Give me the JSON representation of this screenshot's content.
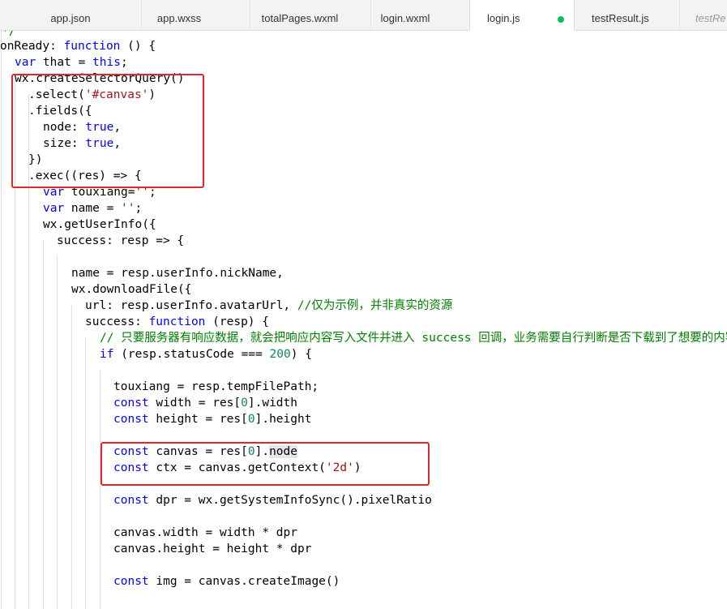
{
  "tabs": [
    {
      "label": "app.json"
    },
    {
      "label": "app.wxss"
    },
    {
      "label": "totalPages.wxml"
    },
    {
      "label": "login.wxml"
    },
    {
      "label": "login.js",
      "active": true,
      "modified": true
    },
    {
      "label": "testResult.js"
    },
    {
      "label": "testRe",
      "preview": true
    }
  ],
  "colors": {
    "keyword": "#0000ff",
    "string": "#a31515",
    "number": "#09885a",
    "comment": "#008000",
    "highlight_box": "#e12727",
    "modified_dot": "#07c160"
  },
  "code": {
    "l0_partial": "*/",
    "l1": {
      "fn": "onReady: ",
      "kw": "function",
      "rest": " () {"
    },
    "l2": {
      "kw1": "var",
      "mid": " that = ",
      "kw2": "this",
      "end": ";"
    },
    "l3": "wx.createSelectorQuery()",
    "l4": {
      "a": ".select(",
      "s": "'#canvas'",
      "b": ")"
    },
    "l5": ".fields({",
    "l6": {
      "a": "node: ",
      "kw": "true",
      "b": ","
    },
    "l7": {
      "a": "size: ",
      "kw": "true",
      "b": ","
    },
    "l8": "})",
    "l9": ".exec((res) => {",
    "l10": {
      "kw": "var",
      "a": " touxiang=",
      "s": "''",
      "b": ";"
    },
    "l11": {
      "kw": "var",
      "a": " name = ",
      "s": "''",
      "b": ";"
    },
    "l12": "wx.getUserInfo({",
    "l13": "success: resp => {",
    "l15": "name = resp.userInfo.nickName,",
    "l16": "wx.downloadFile({",
    "l17": {
      "a": "url: resp.userInfo.avatarUrl, ",
      "c": "//仅为示例，并非真实的资源"
    },
    "l18": {
      "a": "success: ",
      "kw": "function",
      "b": " (resp) {"
    },
    "l19": "// 只要服务器有响应数据，就会把响应内容写入文件并进入 success 回调，业务需要自行判断是否下载到了想要的内容",
    "l20": {
      "kw": "if",
      "a": " (resp.statusCode === ",
      "n": "200",
      "b": ") {"
    },
    "l22": "touxiang = resp.tempFilePath;",
    "l23": {
      "kw": "const",
      "a": " width = res[",
      "n": "0",
      "b": "].width"
    },
    "l24": {
      "kw": "const",
      "a": " height = res[",
      "n": "0",
      "b": "].height"
    },
    "l26": {
      "kw": "const",
      "a": " canvas = res[",
      "n": "0",
      "b": "].",
      "h": "node"
    },
    "l27": {
      "kw": "const",
      "a": " ctx = canvas.getContext(",
      "s": "'2d'",
      "b": ")"
    },
    "l29": {
      "kw": "const",
      "a": " dpr = wx.getSystemInfoSync().pixelRatio"
    },
    "l31": "canvas.width = width * dpr",
    "l32": "canvas.height = height * dpr",
    "l34": {
      "kw": "const",
      "a": " img = canvas.createImage()"
    }
  }
}
